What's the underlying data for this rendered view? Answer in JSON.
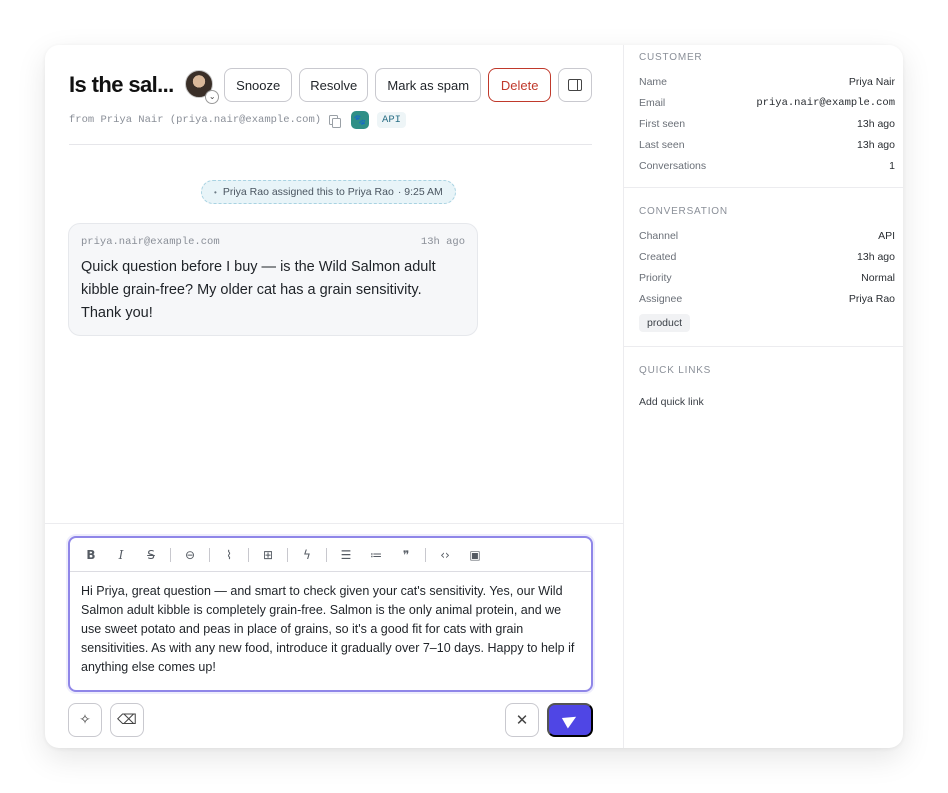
{
  "ticket": {
    "title": "Is the sal...",
    "from_text": "from Priya Nair (priya.nair@example.com)",
    "channel_tag": "API"
  },
  "actions": {
    "snooze": "Snooze",
    "resolve": "Resolve",
    "spam": "Mark as spam",
    "delete": "Delete"
  },
  "timeline": {
    "assignment": "Priya Rao assigned this to Priya Rao",
    "assignment_time": "· 9:25 AM",
    "message": {
      "sender": "priya.nair@example.com",
      "time": "13h ago",
      "body": "Quick question before I buy — is the Wild Salmon adult kibble grain-free? My older cat has a grain sensitivity. Thank you!"
    }
  },
  "composer": {
    "reply_text": "Hi Priya, great question — and smart to check given your cat's sensitivity. Yes, our Wild Salmon adult kibble is completely grain-free. Salmon is the only animal protein, and we use sweet potato and peas in place of grains, so it's a good fit for cats with grain sensitivities. As with any new food, introduce it gradually over 7–10 days. Happy to help if anything else comes up!",
    "toolbar_icons": [
      "bold-icon",
      "italic-icon",
      "strikethrough-icon",
      "link-icon",
      "attachment-icon",
      "book-icon",
      "bolt-icon",
      "bullet-list-icon",
      "numbered-list-icon",
      "quote-icon",
      "code-icon",
      "code-block-icon"
    ]
  },
  "sidebar": {
    "customer": {
      "title": "CUSTOMER",
      "rows": [
        {
          "k": "Name",
          "v": "Priya Nair"
        },
        {
          "k": "Email",
          "v": "priya.nair@example.com"
        },
        {
          "k": "First seen",
          "v": "13h ago"
        },
        {
          "k": "Last seen",
          "v": "13h ago"
        },
        {
          "k": "Conversations",
          "v": "1"
        }
      ]
    },
    "conversation": {
      "title": "CONVERSATION",
      "rows": [
        {
          "k": "Channel",
          "v": "API"
        },
        {
          "k": "Created",
          "v": "13h ago"
        },
        {
          "k": "Priority",
          "v": "Normal"
        },
        {
          "k": "Assignee",
          "v": "Priya Rao"
        }
      ],
      "tag": "product"
    },
    "quick_links": {
      "title": "QUICK LINKS",
      "add": "Add quick link"
    }
  },
  "colors": {
    "accent": "#4f46e5",
    "danger": "#c0392b",
    "focus_border": "#8f86e8"
  }
}
